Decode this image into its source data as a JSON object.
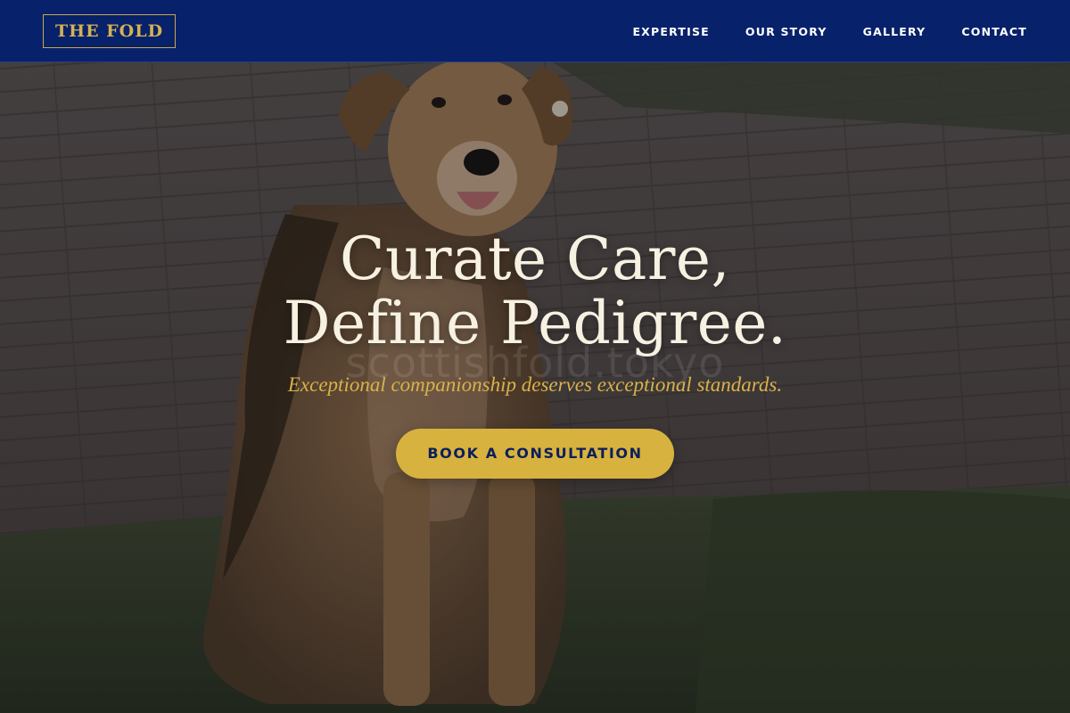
{
  "brand": {
    "logo_text": "THE FOLD"
  },
  "nav": {
    "items": [
      {
        "label": "EXPERTISE"
      },
      {
        "label": "OUR STORY"
      },
      {
        "label": "GALLERY"
      },
      {
        "label": "CONTACT"
      }
    ]
  },
  "hero": {
    "headline_line1": "Curate Care,",
    "headline_line2": "Define Pedigree.",
    "watermark": "scottishfold.tokyo",
    "tagline": "Exceptional companionship deserves exceptional standards.",
    "cta_label": "BOOK A CONSULTATION",
    "background_image": "dog-sitting-on-grass-photo"
  },
  "colors": {
    "header_bg": "#07216a",
    "accent_gold": "#d8b23e",
    "headline": "#f7f1e2",
    "cta_text": "#0b1f5c"
  }
}
